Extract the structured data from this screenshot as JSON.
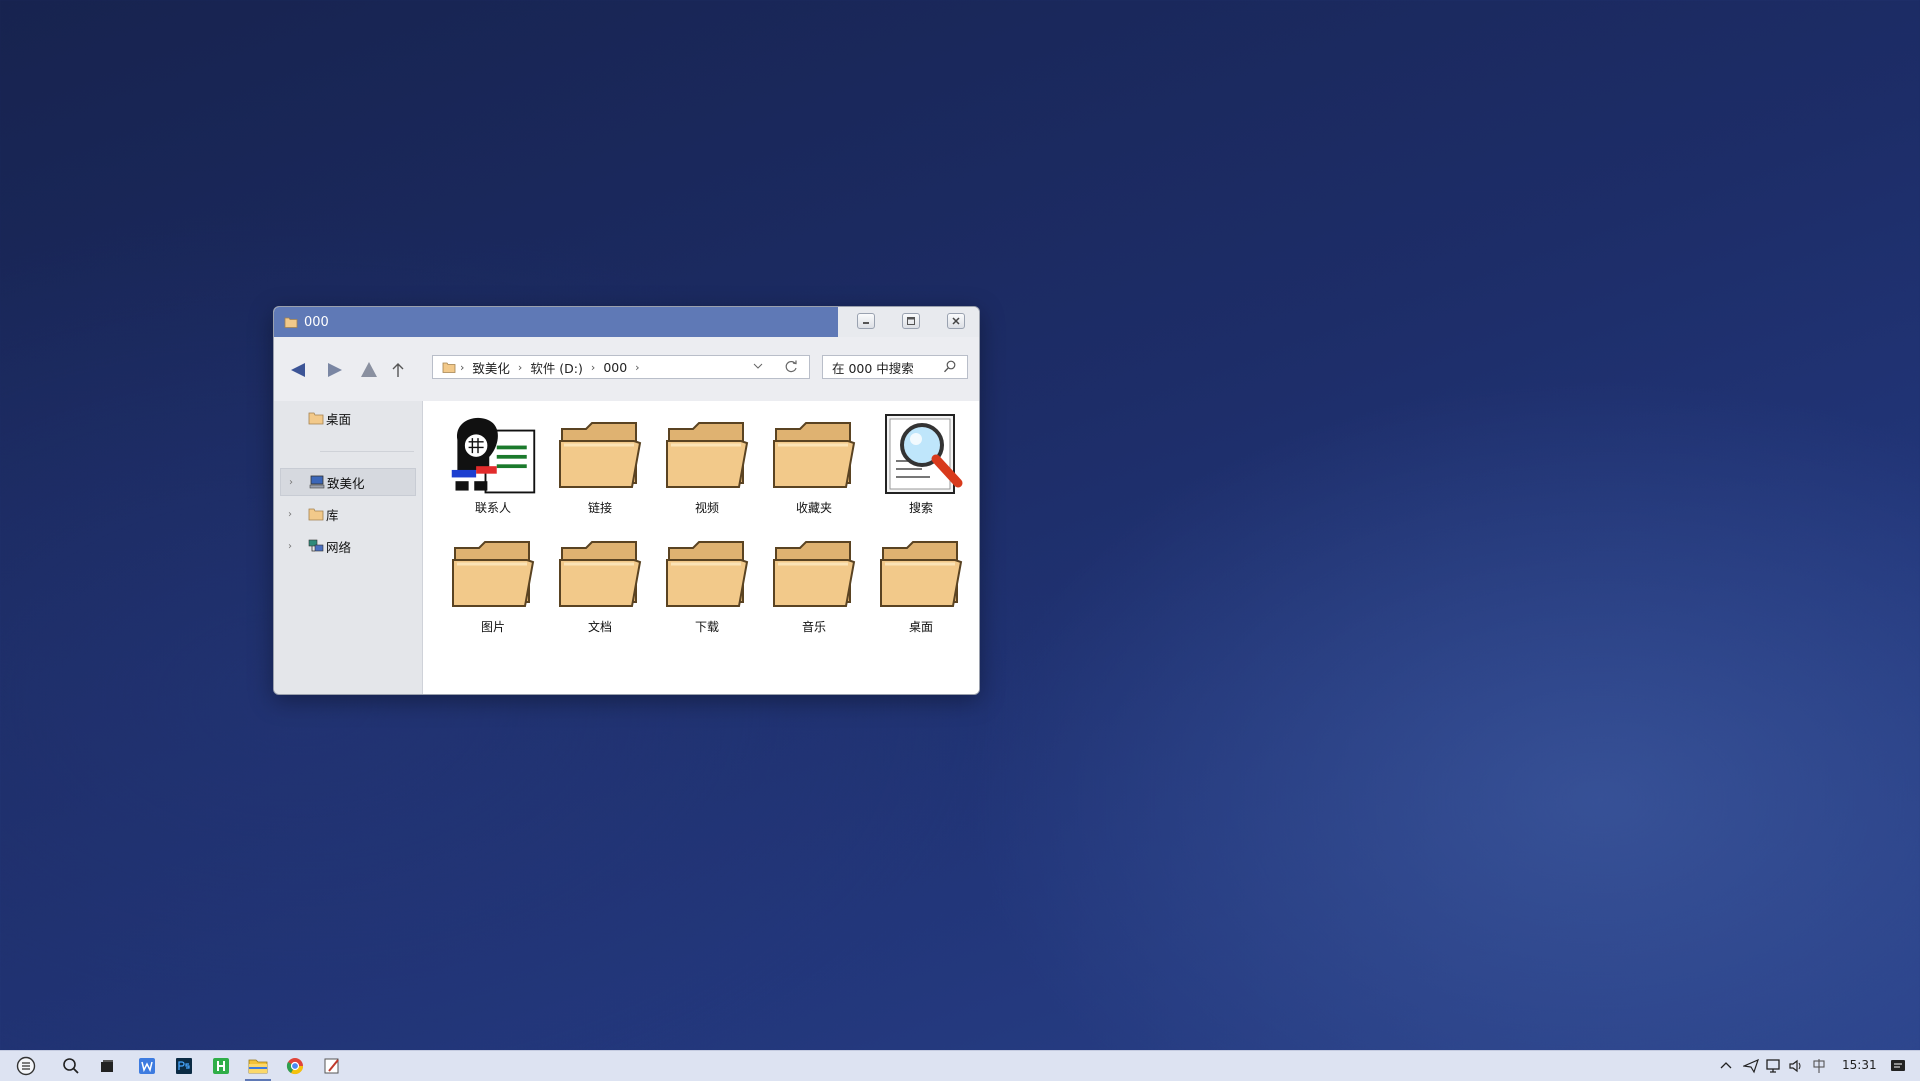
{
  "window": {
    "title": "000",
    "minimize_label": "–",
    "maximize_label": "▢",
    "close_label": "×"
  },
  "address_bar": {
    "crumbs": [
      "致美化",
      "软件 (D:)",
      "000"
    ],
    "separator": "›"
  },
  "search": {
    "placeholder": "在 000 中搜索"
  },
  "sidebar": {
    "pinned": "桌面",
    "items": [
      {
        "label": "致美化",
        "icon": "computer-icon",
        "selected": true
      },
      {
        "label": "库",
        "icon": "folder-icon",
        "selected": false
      },
      {
        "label": "网络",
        "icon": "network-icon",
        "selected": false
      }
    ]
  },
  "items": [
    {
      "label": "联系人",
      "icon": "contacts-icon"
    },
    {
      "label": "链接",
      "icon": "folder-icon"
    },
    {
      "label": "视频",
      "icon": "folder-icon"
    },
    {
      "label": "收藏夹",
      "icon": "folder-icon"
    },
    {
      "label": "搜索",
      "icon": "search-document-icon"
    },
    {
      "label": "图片",
      "icon": "folder-icon"
    },
    {
      "label": "文档",
      "icon": "folder-icon"
    },
    {
      "label": "下载",
      "icon": "folder-icon"
    },
    {
      "label": "音乐",
      "icon": "folder-icon"
    },
    {
      "label": "桌面",
      "icon": "folder-icon"
    }
  ],
  "taskbar": {
    "apps": [
      "start-icon",
      "search-icon",
      "task-view-icon",
      "word-icon",
      "photoshop-icon",
      "hbuilder-icon",
      "file-explorer-icon",
      "chrome-icon",
      "pen-icon"
    ],
    "clock": "15:31"
  },
  "colors": {
    "title_bar": "#5f79b6",
    "folder": "#f2c98a",
    "desktop": "#1d2d68"
  }
}
